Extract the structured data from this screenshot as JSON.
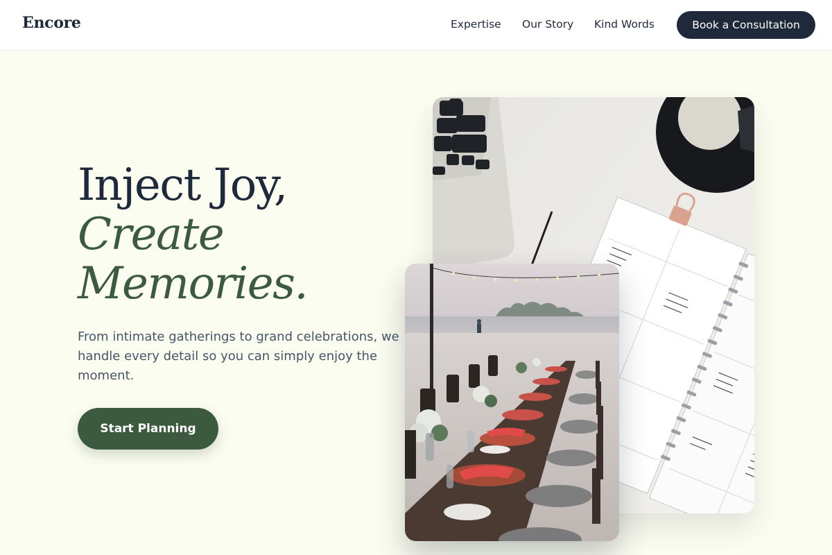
{
  "brand": {
    "name": "Encore"
  },
  "nav": {
    "links": [
      "Expertise",
      "Our Story",
      "Kind Words"
    ],
    "cta_label": "Book a Consultation"
  },
  "hero": {
    "headline_line1": "Inject Joy,",
    "headline_line2": "Create",
    "headline_line3": "Memories.",
    "subtext": "From intimate gatherings to grand celebrations, we handle every detail so you can simply enjoy the moment.",
    "button_label": "Start Planning"
  },
  "colors": {
    "page_background": "#fcfdf1",
    "navy": "#1e293b",
    "forest_green": "#3b5a3e",
    "body_text": "#475569"
  },
  "images": {
    "planner_photo": "laptop-and-planner-desk-photo",
    "dinner_photo": "beach-dinner-table-setup-photo"
  }
}
